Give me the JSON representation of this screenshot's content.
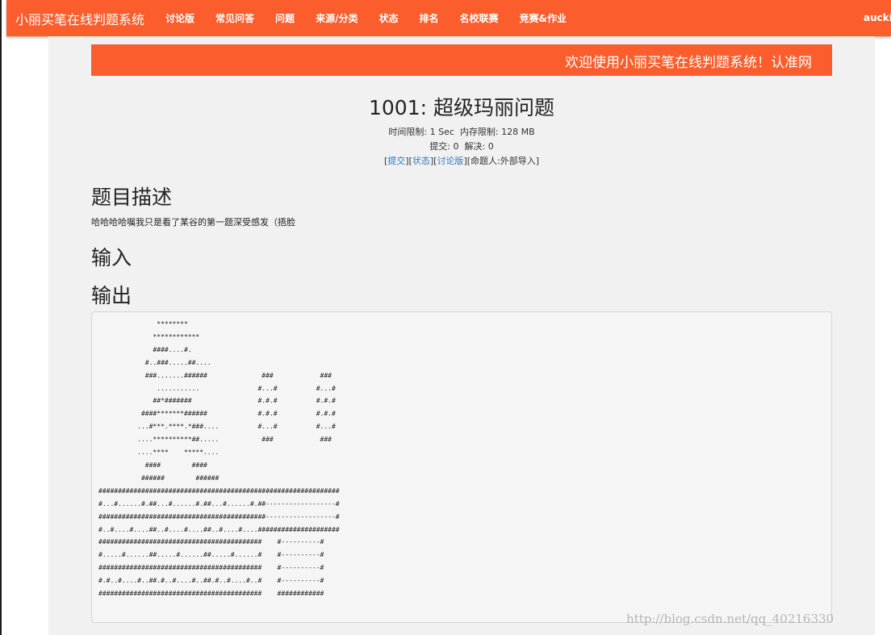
{
  "nav": {
    "brand": "小丽买笔在线判题系统",
    "items": [
      "讨论版",
      "常见问答",
      "问题",
      "来源/分类",
      "状态",
      "排名",
      "名校联赛",
      "竞赛&作业"
    ],
    "user": "aucki"
  },
  "marquee": {
    "text": "欢迎使用小丽买笔在线判题系统！认准网"
  },
  "problem": {
    "title": "1001: 超级玛丽问题",
    "time_limit_label": "时间限制:",
    "time_limit": "1 Sec",
    "memory_limit_label": "内存限制:",
    "memory_limit": "128 MB",
    "submit_label": "提交:",
    "submit_count": "0",
    "solved_label": "解决:",
    "solved_count": "0",
    "links": {
      "submit": "提交",
      "status": "状态",
      "discuss": "讨论版"
    },
    "setter": "[命题人:外部导入]"
  },
  "sections": {
    "description_heading": "题目描述",
    "description_text": "哈哈哈哈嘱我只是看了某谷的第一题深受感发（捂脸",
    "input_heading": "输入",
    "output_heading": "输出"
  },
  "output_art": [
    "               ********",
    "              ************",
    "              ####....#.",
    "            #..###.....##....",
    "            ###.......######              ###            ###",
    "               ...........               #...#          #...#",
    "              ##*#######                 #.#.#          #.#.#",
    "           ####*******######             #.#.#          #.#.#",
    "          ...#***.****.*###....          #...#          #...#",
    "          ....**********##.....           ###            ###",
    "          ....****    *****....",
    "            ####        ####",
    "           ######        ######",
    "##############################################################",
    "#...#......#.##...#......#.##...#......#.##------------------#",
    "###########################################------------------#",
    "#..#....#....##..#....#....##..#....#....#####################",
    "##########################################    #----------#",
    "#.....#......##.....#......##.....#......#    #----------#",
    "##########################################    #----------#",
    "#.#..#....#..##.#..#....#..##.#..#....#..#    #----------#",
    "##########################################    ############"
  ],
  "watermark": "http://blog.csdn.net/qq_40216330"
}
